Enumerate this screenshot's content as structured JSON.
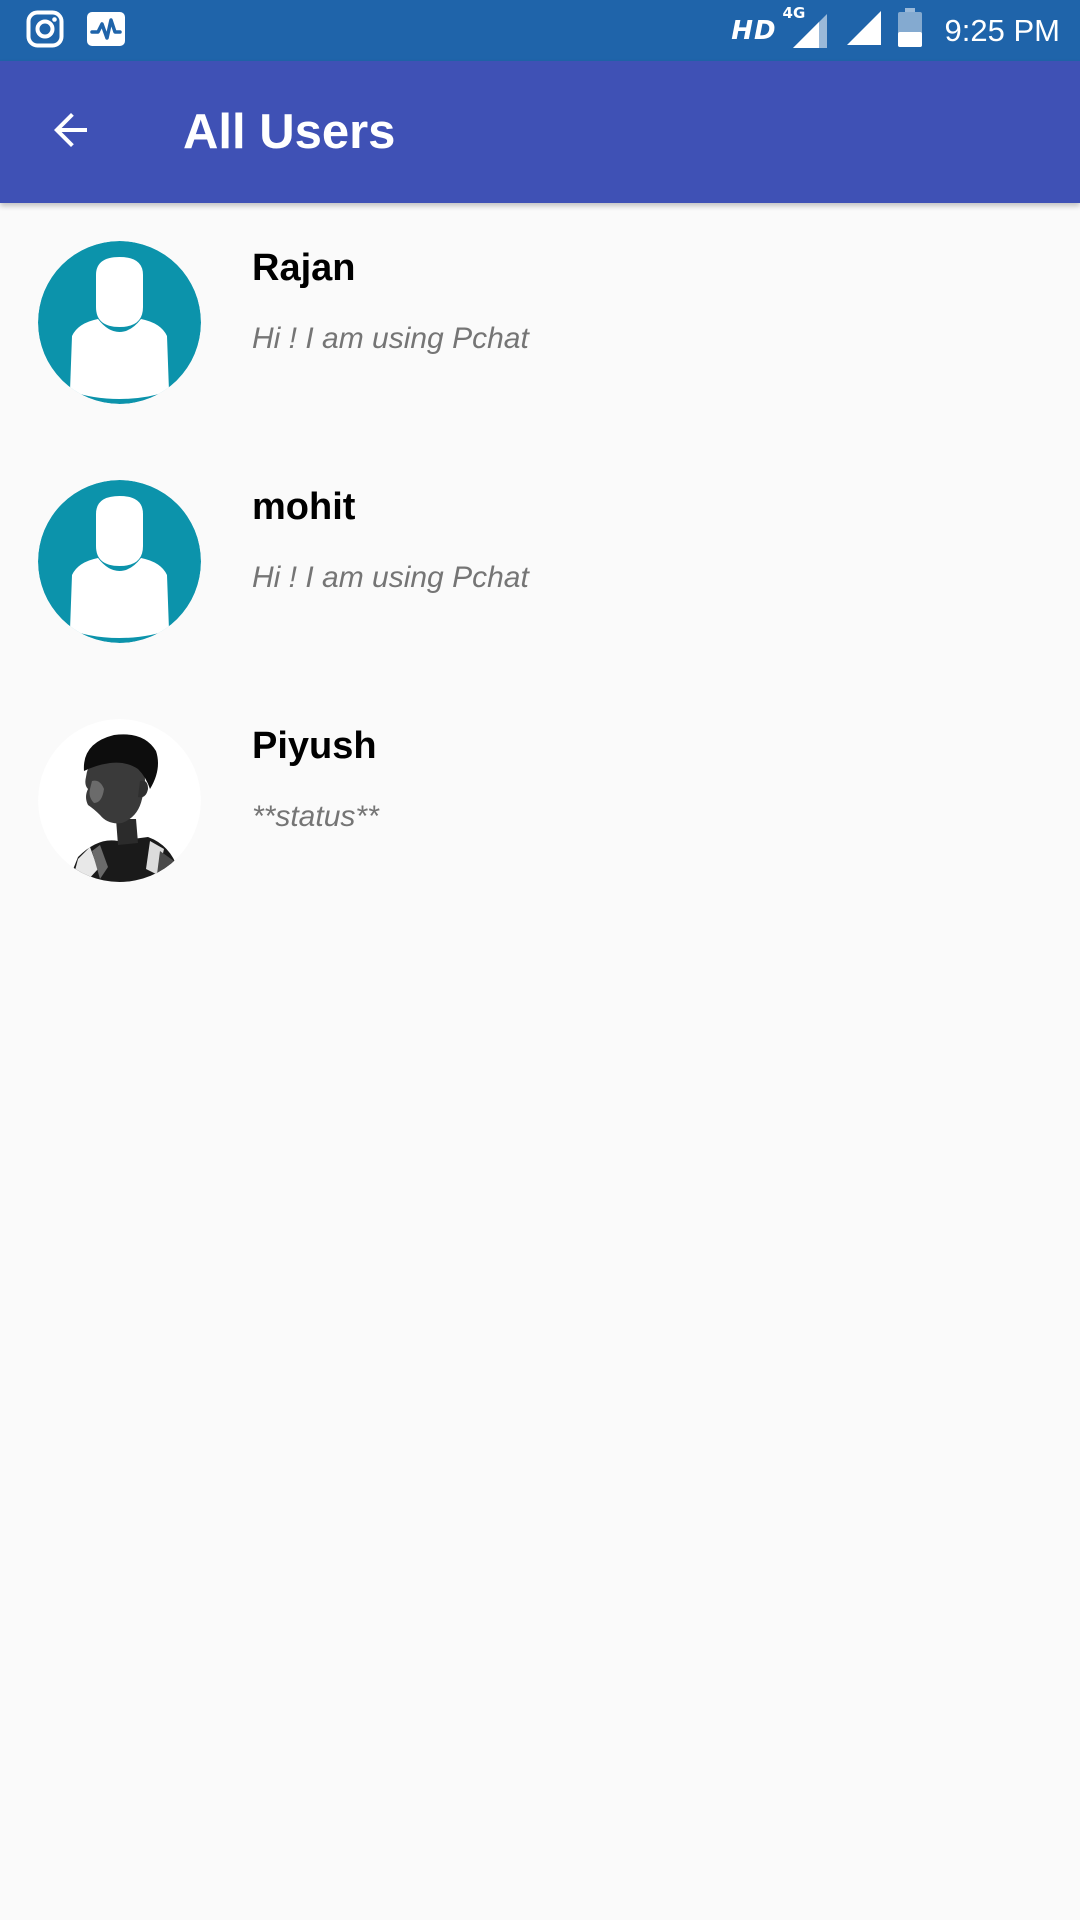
{
  "status_bar": {
    "network_type": "HD",
    "network_gen": "4G",
    "time": "9:25 PM",
    "left_icons": [
      "instagram-icon",
      "activity-pulse-icon"
    ],
    "right_icons": [
      "signal-4g-icon",
      "signal-icon",
      "battery-icon"
    ]
  },
  "app_bar": {
    "title": "All Users",
    "back_icon": "arrow-back-icon",
    "background_color": "#3f51b5"
  },
  "users": [
    {
      "name": "Rajan",
      "status": "Hi ! I am using Pchat",
      "avatar": "default-avatar-icon"
    },
    {
      "name": "mohit",
      "status": "Hi ! I am using Pchat",
      "avatar": "default-avatar-icon"
    },
    {
      "name": "Piyush",
      "status": "**status**",
      "avatar": "profile-photo"
    }
  ],
  "colors": {
    "status_bar": "#1f64aa",
    "app_bar": "#3f51b5",
    "avatar_teal": "#0c93ab",
    "background": "#fafafa",
    "status_text": "#757575"
  }
}
